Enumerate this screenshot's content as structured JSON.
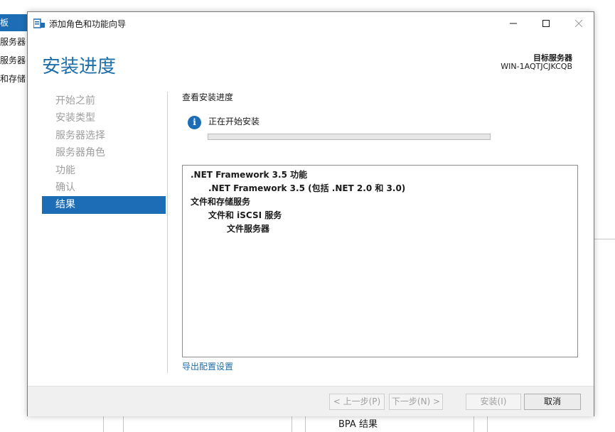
{
  "background": {
    "sidebar_items": [
      {
        "label": "板",
        "active": true
      },
      {
        "label": "服务器",
        "active": false
      },
      {
        "label": "服务器",
        "active": false
      },
      {
        "label": "和存储",
        "active": false
      }
    ],
    "bpa_label": "BPA 结果"
  },
  "dialog": {
    "window_title": "添加角色和功能向导",
    "page_title": "安装进度",
    "target_server_label": "目标服务器",
    "target_server_value": "WIN-1AQTJCJKCQB",
    "nav_items": [
      {
        "label": "开始之前",
        "active": false
      },
      {
        "label": "安装类型",
        "active": false
      },
      {
        "label": "服务器选择",
        "active": false
      },
      {
        "label": "服务器角色",
        "active": false
      },
      {
        "label": "功能",
        "active": false
      },
      {
        "label": "确认",
        "active": false
      },
      {
        "label": "结果",
        "active": true
      }
    ],
    "content_heading": "查看安装进度",
    "status_text": "正在开始安装",
    "progress_percent": 0,
    "results": [
      {
        "label": ".NET Framework 3.5 功能",
        "level": 0
      },
      {
        "label": ".NET Framework 3.5 (包括 .NET 2.0 和 3.0)",
        "level": 1
      },
      {
        "label": "文件和存储服务",
        "level": 0
      },
      {
        "label": "文件和 iSCSI 服务",
        "level": 1
      },
      {
        "label": "文件服务器",
        "level": 2
      }
    ],
    "export_link": "导出配置设置",
    "buttons": {
      "prev": "< 上一步(P)",
      "next": "下一步(N) >",
      "install": "安装(I)",
      "cancel": "取消"
    },
    "colors": {
      "accent": "#1c6db5",
      "title": "#1e6ea8"
    }
  }
}
